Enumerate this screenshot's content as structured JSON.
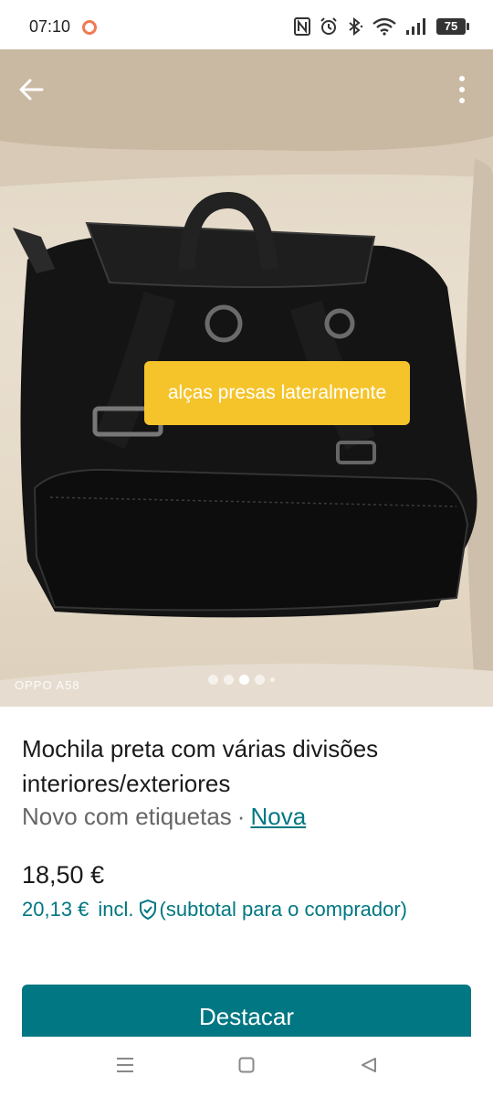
{
  "status_bar": {
    "time": "07:10",
    "battery": "75",
    "icons": [
      "notification-ring-icon",
      "nfc-icon",
      "alarm-icon",
      "bluetooth-icon",
      "wifi-icon",
      "signal-icon",
      "battery-icon"
    ]
  },
  "gallery": {
    "caption": "alças presas lateralmente",
    "watermark": "OPPO A58",
    "page_count": 5,
    "active_page": 3,
    "caption_color": "#f5c42b"
  },
  "listing": {
    "title": "Mochila preta com várias divisões interiores/exteriores",
    "condition": "Novo com etiquetas",
    "separator": "·",
    "condition_link": "Nova",
    "price": "18,50 €",
    "buyer_price": "20,13 €",
    "buyer_price_incl": "incl.",
    "buyer_price_note": "(subtotal para o comprador)"
  },
  "actions": {
    "promote_label": "Destacar"
  },
  "colors": {
    "accent": "#007782",
    "muted_text": "#666666"
  }
}
